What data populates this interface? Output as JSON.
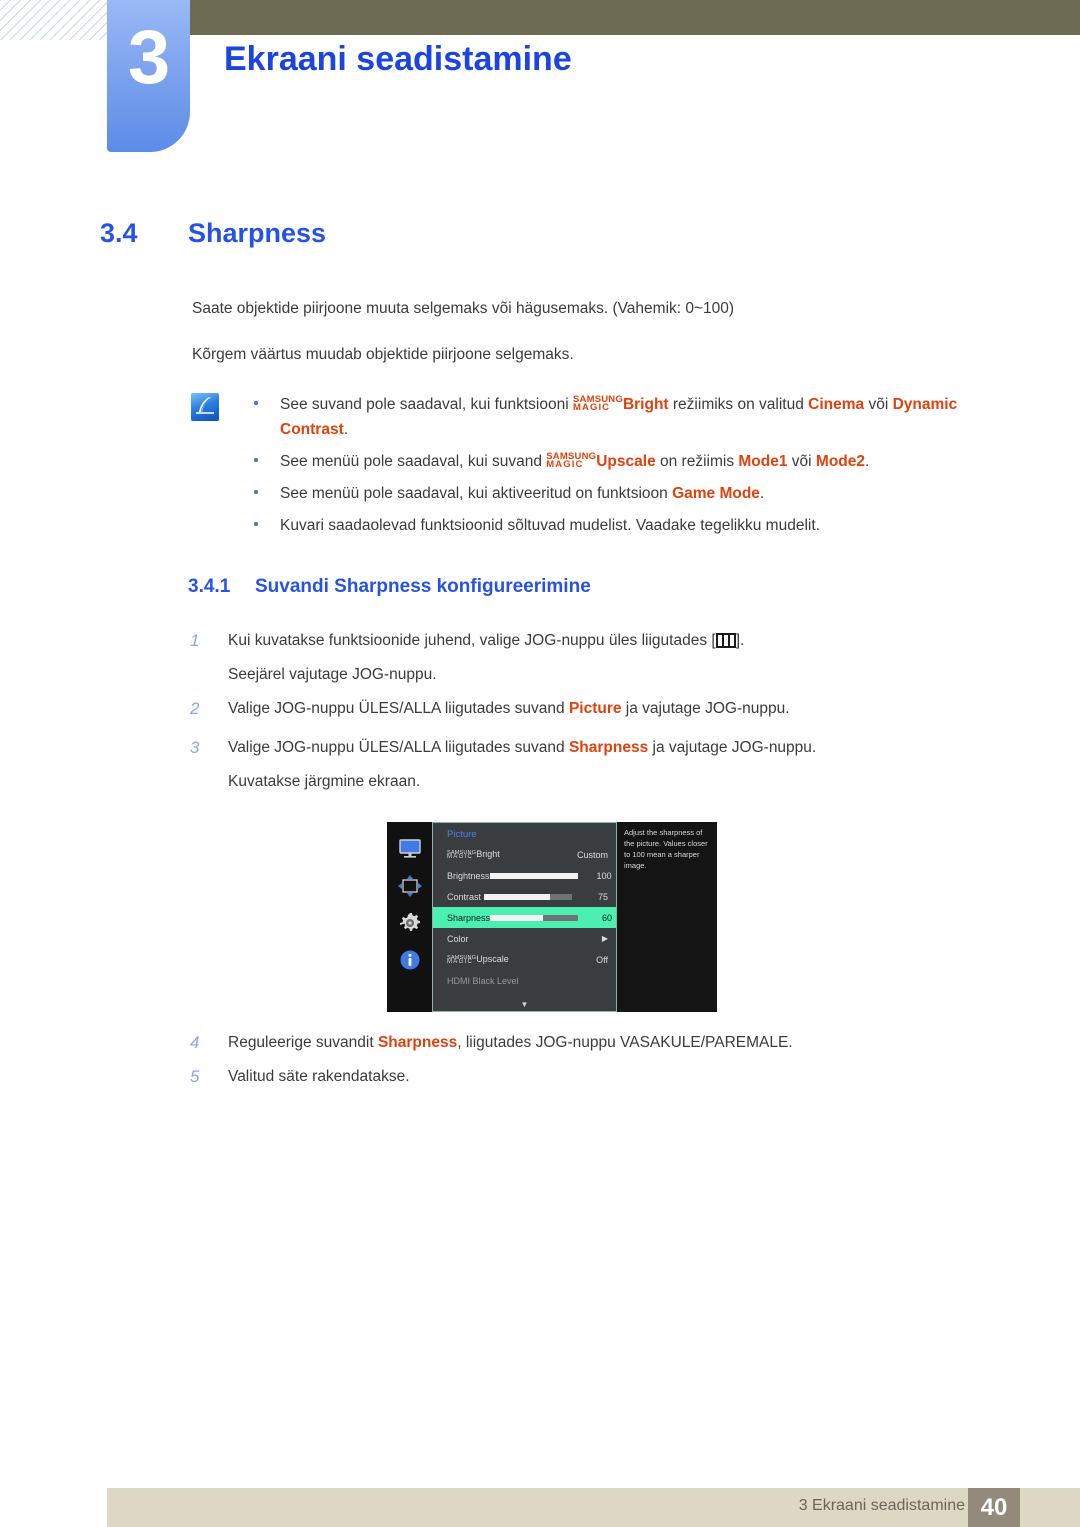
{
  "header": {
    "chapter_number": "3",
    "chapter_title": "Ekraani seadistamine"
  },
  "section": {
    "number": "3.4",
    "title": "Sharpness"
  },
  "body": {
    "paragraph_1": "Saate objektide piirjoone muuta selgemaks või hägusemaks. (Vahemik: 0~100)",
    "paragraph_2": "Kõrgem väärtus muudab objektide piirjoone selgemaks."
  },
  "note": {
    "icon": "note-pen-icon",
    "items": [
      {
        "pre": "See suvand pole saadaval, kui funktsiooni ",
        "magic_top": "SAMSUNG",
        "magic_bottom": "MAGIC",
        "magic_word": "Bright",
        "mid": " režiimiks on valitud ",
        "em1": "Cinema",
        "conj": " või ",
        "em2": "Dynamic Contrast",
        "post": "."
      },
      {
        "pre": "See menüü pole saadaval, kui suvand ",
        "magic_top": "SAMSUNG",
        "magic_bottom": "MAGIC",
        "magic_word": "Upscale",
        "mid": " on režiimis ",
        "em1": "Mode1",
        "conj": " või ",
        "em2": "Mode2",
        "post": "."
      },
      {
        "pre": "See menüü pole saadaval, kui aktiveeritud on funktsioon ",
        "em1": "Game Mode",
        "post": "."
      },
      {
        "pre": "Kuvari saadaolevad funktsioonid sõltuvad mudelist. Vaadake tegelikku mudelit.",
        "post": ""
      }
    ]
  },
  "subsection": {
    "number": "3.4.1",
    "title": "Suvandi Sharpness konfigureerimine"
  },
  "steps": [
    {
      "num": "1",
      "text_before": "Kui kuvatakse funktsioonide juhend, valige JOG-nuppu üles liigutades [",
      "icon": "jog-up-icon",
      "text_after": "].",
      "sub": "Seejärel vajutage JOG-nuppu."
    },
    {
      "num": "2",
      "pre": "Valige JOG-nuppu ÜLES/ALLA liigutades suvand ",
      "em": "Picture",
      "post": " ja vajutage JOG-nuppu."
    },
    {
      "num": "3",
      "pre": "Valige JOG-nuppu ÜLES/ALLA liigutades suvand ",
      "em": "Sharpness",
      "post": " ja vajutage JOG-nuppu.",
      "sub": "Kuvatakse järgmine ekraan."
    },
    {
      "num": "4",
      "pre": "Reguleerige suvandit ",
      "em": "Sharpness",
      "post": ", liigutades JOG-nuppu VASAKULE/PAREMALE."
    },
    {
      "num": "5",
      "pre": "Valitud säte rakendatakse.",
      "em": "",
      "post": ""
    }
  ],
  "osd": {
    "rail_icons": [
      "monitor-icon",
      "move-arrows-icon",
      "gear-icon",
      "info-icon"
    ],
    "title": "Picture",
    "rows": [
      {
        "label": "",
        "magic_top": "SAMSUNG",
        "magic_bottom": "MAGIC",
        "magic_word": "Bright",
        "value": "Custom",
        "bar": null,
        "selected": false,
        "dim": false
      },
      {
        "label": "Brightness",
        "value": "100",
        "bar": 100,
        "selected": false,
        "dim": false
      },
      {
        "label": "Contrast",
        "value": "75",
        "bar": 75,
        "selected": false,
        "dim": false
      },
      {
        "label": "Sharpness",
        "value": "60",
        "bar": 60,
        "selected": true,
        "dim": false
      },
      {
        "label": "Color",
        "value": "▶",
        "bar": null,
        "selected": false,
        "dim": false
      },
      {
        "label": "",
        "magic_top": "SAMSUNG",
        "magic_bottom": "MAGIC",
        "magic_word": "Upscale",
        "value": "Off",
        "bar": null,
        "selected": false,
        "dim": false
      },
      {
        "label": "HDMI Black Level",
        "value": "",
        "bar": null,
        "selected": false,
        "dim": true
      }
    ],
    "scroll_caret": "▼",
    "description": "Adjust the sharpness of the picture. Values closer to 100 mean a sharper image.",
    "highlight_color": "#4bf0b0"
  },
  "footer": {
    "text": "3 Ekraani seadistamine",
    "page": "40"
  }
}
